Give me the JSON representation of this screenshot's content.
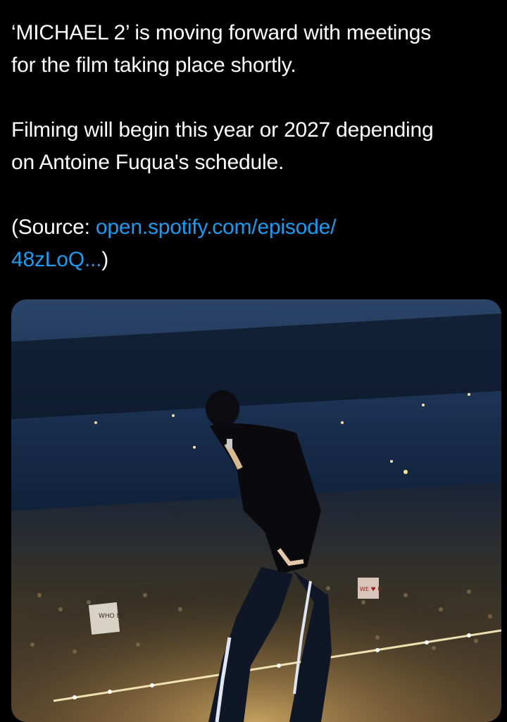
{
  "tweet": {
    "line1": "‘MICHAEL 2’ is moving forward with meetings",
    "line2": "for the film taking place shortly.",
    "line3": "Filming will begin this year or 2027 depending",
    "line4": "on Antoine Fuqua's schedule.",
    "source_prefix": "(Source: ",
    "source_link_line1": "open.spotify.com/episode/",
    "source_link_line2": "48zLoQ...",
    "source_suffix": ")"
  },
  "media": {
    "sign_left": "WHO BE",
    "sign_right": "WE ♥ U"
  },
  "colors": {
    "background": "#000000",
    "text": "#ffffff",
    "link": "#1d9bf0"
  }
}
